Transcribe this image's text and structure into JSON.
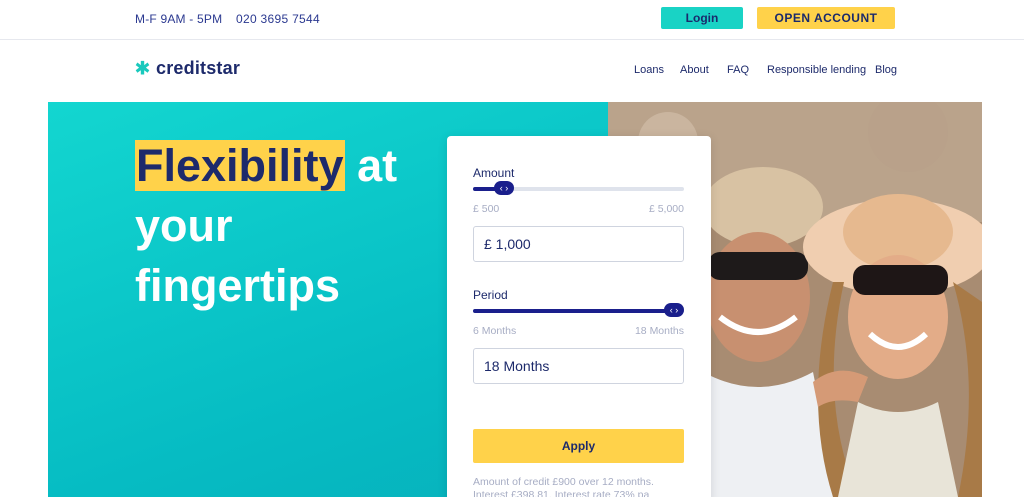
{
  "topbar": {
    "hours": "M-F 9AM - 5PM",
    "phone": "020 3695 7544",
    "login_label": "Login",
    "open_account_label": "OPEN ACCOUNT"
  },
  "header": {
    "logo_text": "creditstar",
    "nav": [
      "Loans",
      "About",
      "FAQ",
      "Responsible lending",
      "Blog"
    ]
  },
  "hero": {
    "headline_highlight": "Flexibility",
    "headline_rest_1": " at",
    "headline_rest_2": "your",
    "headline_rest_3": "fingertips"
  },
  "calculator": {
    "amount_label": "Amount",
    "amount_min": "£ 500",
    "amount_max": "£ 5,000",
    "amount_value": "£ 1,000",
    "amount_level": 0.11,
    "period_label": "Period",
    "period_min": "6 Months",
    "period_max": "18 Months",
    "period_value": "18 Months",
    "period_level": 1.0,
    "apply_label": "Apply",
    "note": "Amount of credit £900 over 12 months. Interest £398.81. Interest rate 73% pa"
  },
  "colors": {
    "accent_teal": "#19d3c5",
    "accent_yellow": "#ffd24a",
    "brand_navy": "#1d2a6b",
    "slider_navy": "#1a1f8c"
  }
}
